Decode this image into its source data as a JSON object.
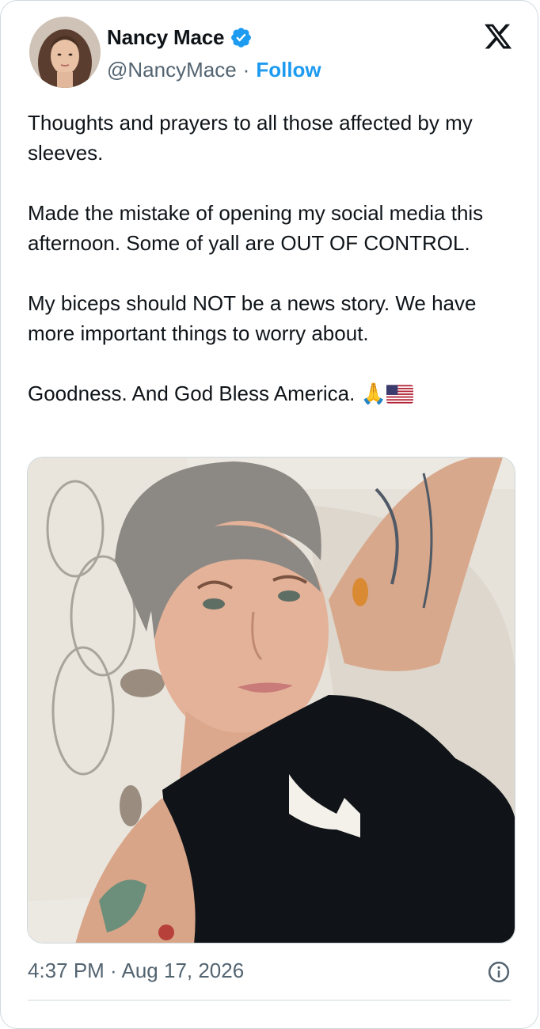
{
  "author": {
    "display_name": "Nancy Mace",
    "handle": "@NancyMace",
    "separator": "·",
    "follow_label": "Follow",
    "verified_color": "#1d9bf0",
    "avatar_icon": "profile-photo"
  },
  "tweet": {
    "text": "Thoughts and prayers to all those affected by my sleeves.\n\nMade the mistake of opening my social media this afternoon. Some of yall are OUT OF CONTROL.\n\nMy biceps should NOT be a news story. We have more important things to worry about.\n\nGoodness. And God Bless America.",
    "emoji_praying": "🙏",
    "flag_icon": "us-flag-icon"
  },
  "media": {
    "type": "photo",
    "icon": "selfie-photo"
  },
  "footer": {
    "timestamp": "4:37 PM · Aug 17, 2026",
    "info_icon": "info-icon"
  },
  "colors": {
    "text": "#0f1419",
    "secondary": "#536471",
    "accent": "#1d9bf0",
    "border": "#cfd9de"
  }
}
